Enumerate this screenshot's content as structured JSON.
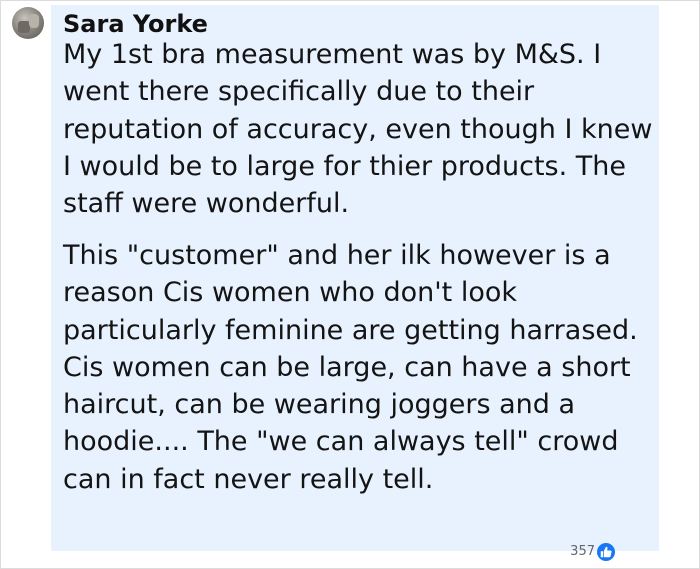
{
  "comment": {
    "author": "Sara Yorke",
    "paragraphs": [
      "My 1st bra measurement was by M&S. I went there specifically due to their reputation of accuracy, even though I knew I would be to large for thier products. The staff were wonderful.",
      "This \"customer\" and her ilk however is a reason Cis women who don't look particularly feminine are getting harrased. Cis women can be large, can have a short haircut, can be wearing joggers and a hoodie.... The \"we can always tell\" crowd can in fact never really tell."
    ],
    "reaction_count": "357",
    "reaction_icon": "like-icon",
    "colors": {
      "bubble": "#e8f2fe",
      "like": "#1877f2"
    }
  }
}
